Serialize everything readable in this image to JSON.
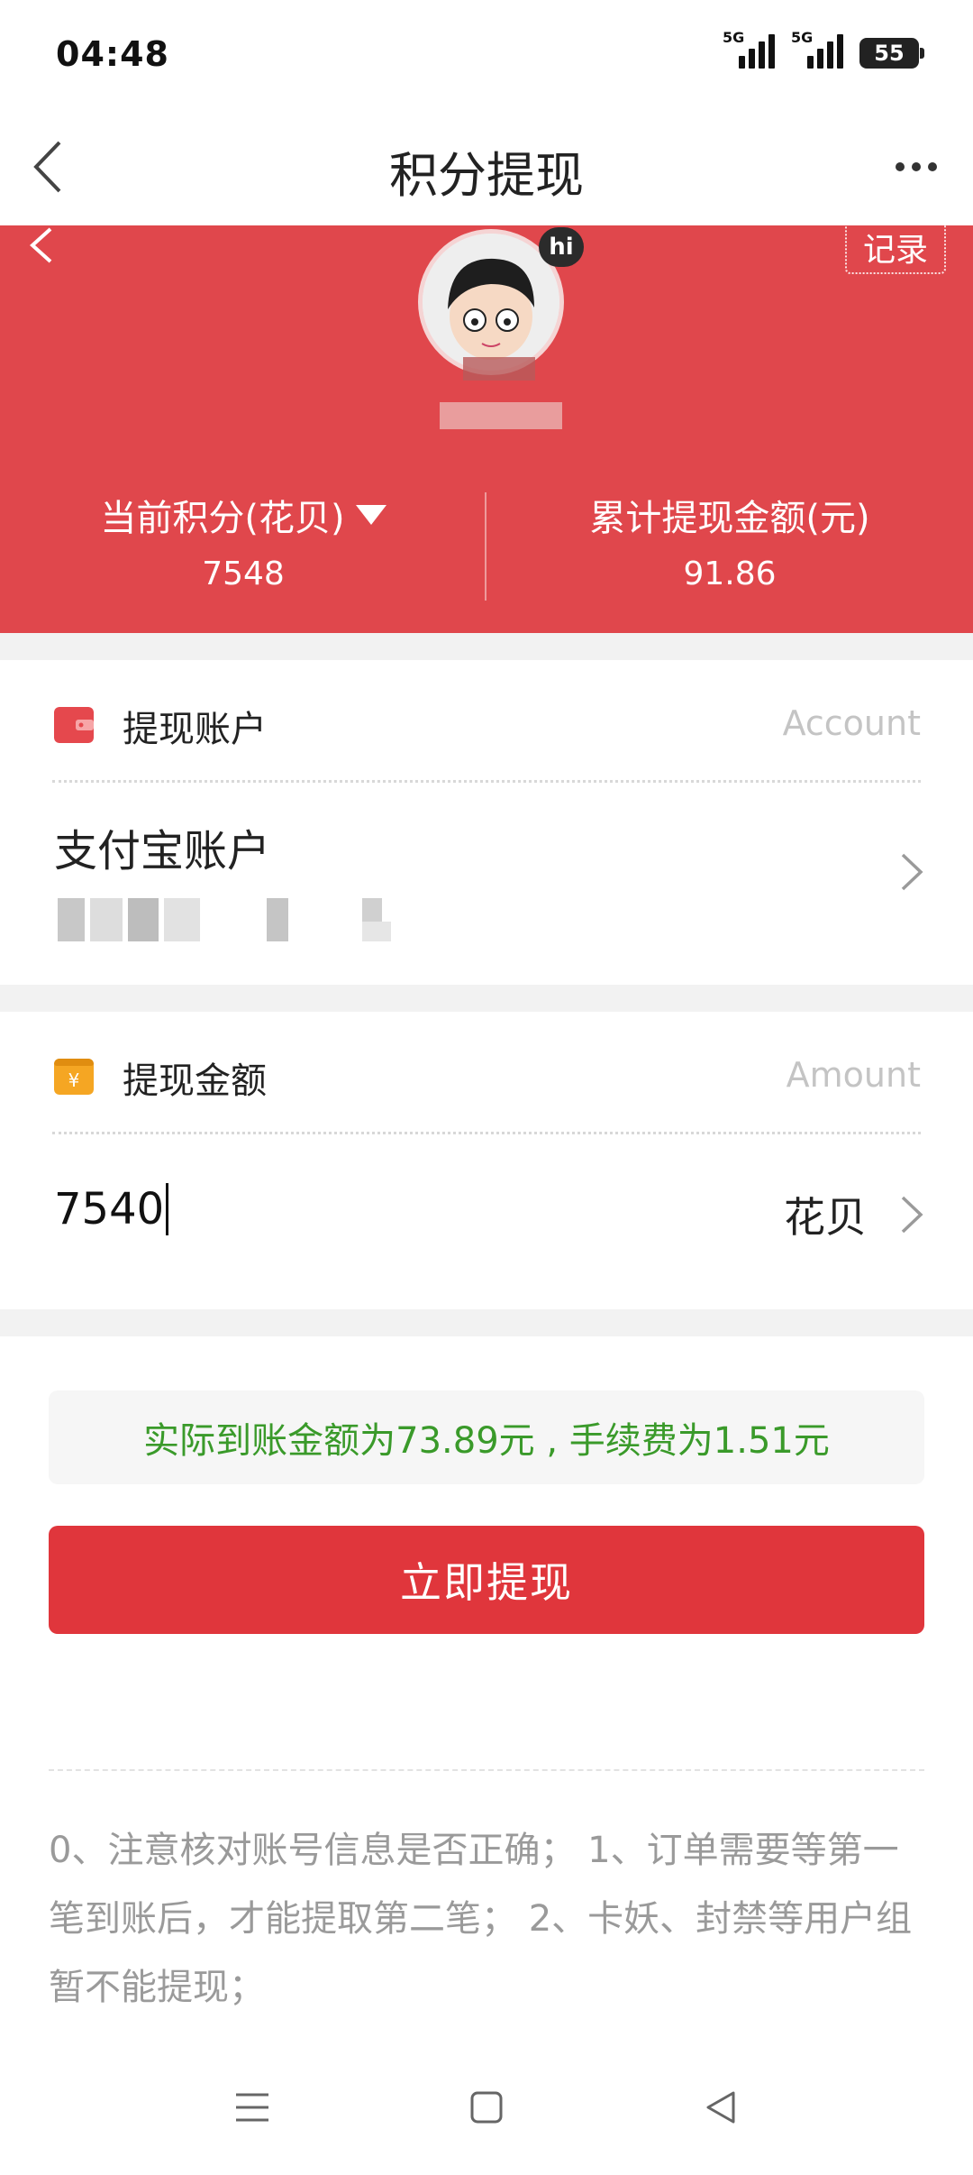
{
  "status_bar": {
    "time": "04:48",
    "network_1": "5G",
    "network_2": "5G",
    "battery": "55"
  },
  "nav": {
    "title": "积分提现"
  },
  "profile": {
    "badge": "hi",
    "record_label": "记录"
  },
  "stats": {
    "points_label": "当前积分(花贝)",
    "points_value": "7548",
    "withdrawn_label": "累计提现金额(元)",
    "withdrawn_value": "91.86"
  },
  "account_section": {
    "title": "提现账户",
    "hint": "Account",
    "account_name": "支付宝账户"
  },
  "amount_section": {
    "title": "提现金额",
    "hint": "Amount",
    "amount_value": "7540",
    "unit": "花贝"
  },
  "notice": "实际到账金额为73.89元 , 手续费为1.51元",
  "submit_label": "立即提现",
  "tips": "0、注意核对账号信息是否正确； 1、订单需要等第一笔到账后，才能提取第二笔； 2、卡妖、封禁等用户组暂不能提现；",
  "colors": {
    "brand_red": "#e0474c",
    "button_red": "#e0363c",
    "notice_green": "#3a9a2a",
    "wallet_icon": "#e5484d",
    "money_icon": "#f5a623"
  },
  "icons": {
    "back": "chevron-left-icon",
    "more": "more-horizontal-icon",
    "account": "wallet-icon",
    "amount": "yuan-icon",
    "points_toggle": "caret-down-icon"
  }
}
